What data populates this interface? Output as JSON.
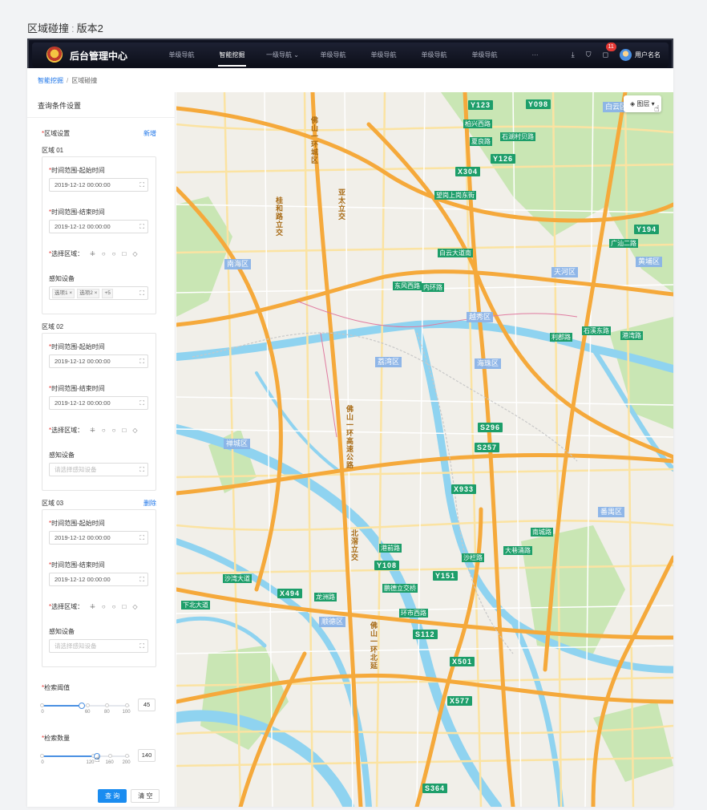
{
  "caption": {
    "title": "区域碰撞",
    "separator": ":",
    "version": "版本2"
  },
  "nav": {
    "brand": "后台管理中心",
    "items": [
      {
        "label": "单级导航"
      },
      {
        "label": "智能挖掘",
        "active": true
      },
      {
        "label": "一级导航 ⌄"
      },
      {
        "label": "单级导航"
      },
      {
        "label": "单级导航"
      },
      {
        "label": "单级导航"
      },
      {
        "label": "单级导航"
      },
      {
        "label": "···"
      }
    ],
    "badge": "11",
    "user_name": "用户名名"
  },
  "breadcrumb": {
    "parent": "智能挖掘",
    "current": "区域碰撞"
  },
  "panel": {
    "title": "查询条件设置",
    "region_setting_label": "区域设置",
    "add_label": "新增",
    "delete_label": "删除",
    "start_label": "时间范围-起始时间",
    "end_label": "时间范围-结束时间",
    "select_area_label": "选择区域：",
    "device_label": "感知设备",
    "device_placeholder": "请选择感知设备",
    "regions": [
      {
        "name": "区域 01",
        "start": "2019-12-12  00:00:00",
        "end": "2019-12-12  00:00:00",
        "tags": [
          "选项1 ×",
          "选项2 ×",
          "+5"
        ]
      },
      {
        "name": "区域 02",
        "start": "2019-12-12  00:00:00",
        "end": "2019-12-12  00:00:00"
      },
      {
        "name": "区域 03",
        "start": "2019-12-12  00:00:00",
        "end": "2019-12-12  00:00:00"
      }
    ],
    "threshold": {
      "label": "检索阈值",
      "value": "45",
      "ticks": [
        "0",
        "60",
        "80",
        "100"
      ]
    },
    "count": {
      "label": "检索数量",
      "value": "140",
      "ticks": [
        "0",
        "120",
        "160",
        "200"
      ]
    },
    "query_btn": "查 询",
    "clear_btn": "清 空"
  },
  "map": {
    "layer_btn": "图层",
    "highways": [
      "Y123",
      "Y098",
      "Y126",
      "X304",
      "Y194",
      "S296",
      "S257",
      "X933",
      "Y108",
      "Y151",
      "X494",
      "S112",
      "X501",
      "X577",
      "S364"
    ],
    "roads": [
      "柏兴西路",
      "石湖村贝路",
      "夏良路",
      "望岗上岗东街",
      "白云大道南",
      "广汕二路",
      "东风西路",
      "内环路",
      "石溪东路",
      "港湾路",
      "利郡路",
      "南城路",
      "大巷涌路",
      "沙湾大道",
      "下北大道",
      "龙洲路",
      "港前路",
      "沙栏路",
      "鹏德立交桥",
      "环市西路"
    ],
    "districts": [
      "白云区",
      "南海区",
      "天河区",
      "黄埔区",
      "越秀区",
      "荔湾区",
      "海珠区",
      "禅城区",
      "番禺区",
      "顺德区"
    ],
    "vertical_labels": [
      "佛山一环城区",
      "佛山一环高速公路",
      "北滘立交",
      "桂和路立交",
      "亚太立交",
      "佛山一环北延"
    ]
  },
  "colors": {
    "accent": "#1a8cf0",
    "highway_label": "#1d9e6a",
    "district_label": "#8ab4e8",
    "expressway": "#f5a93b",
    "water": "#8fd3f0",
    "green": "#c9e6b4"
  }
}
